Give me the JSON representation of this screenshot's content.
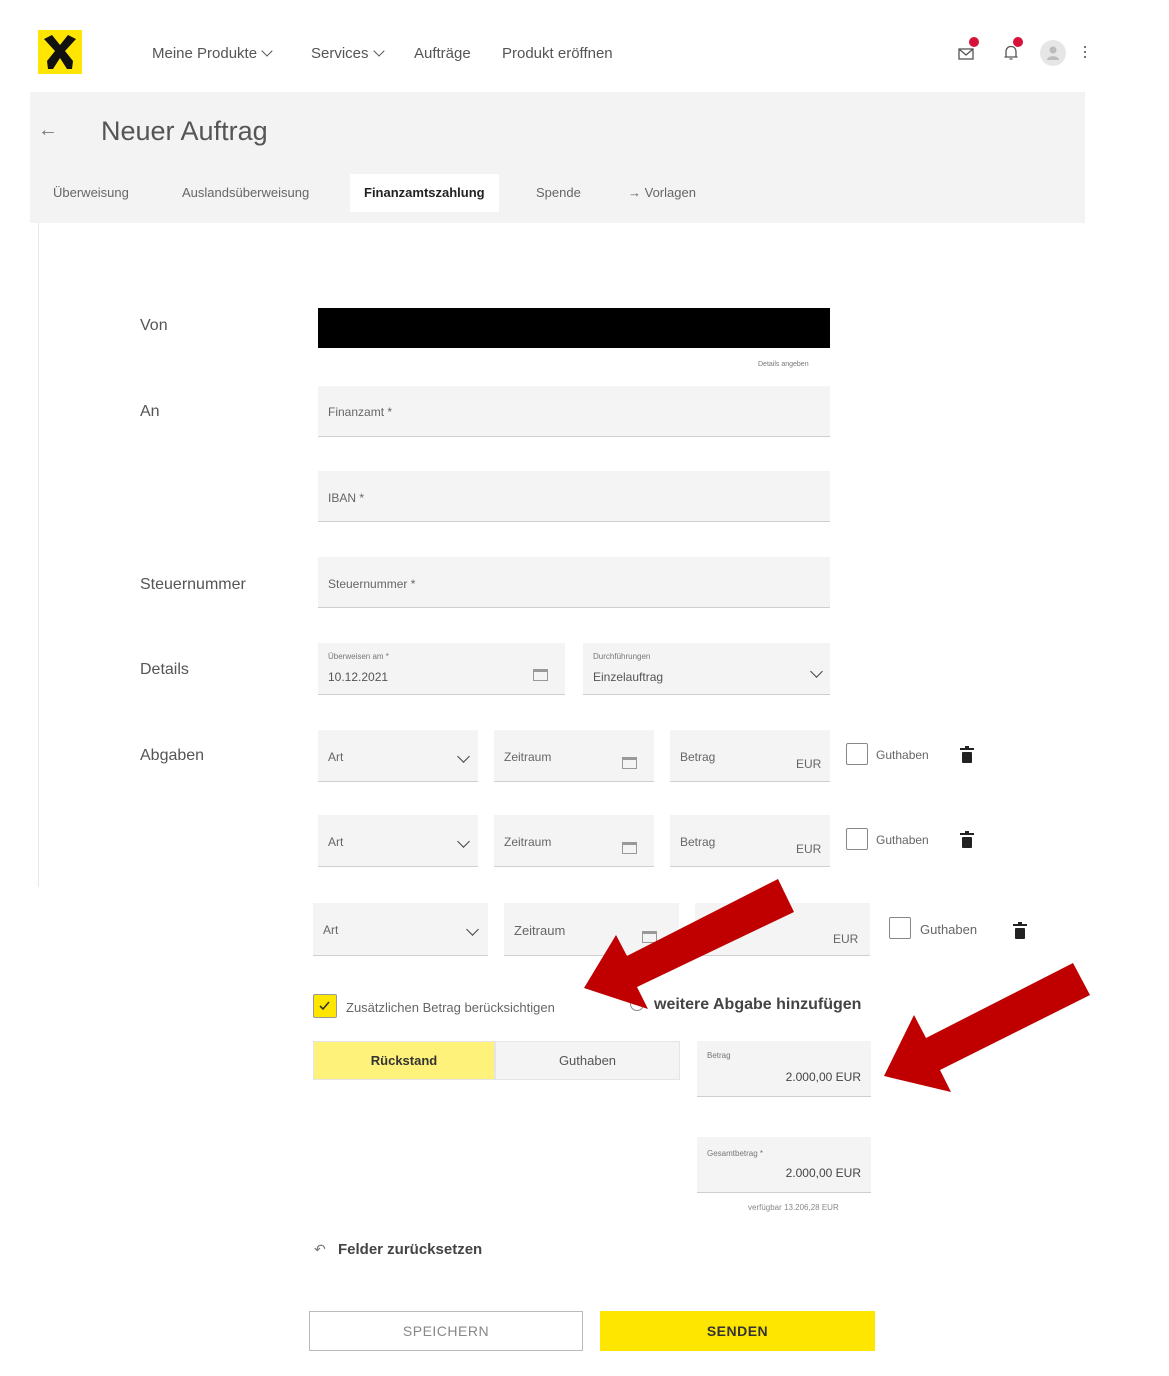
{
  "brand": {
    "accent": "#ffe600",
    "logo": "raiffeisen-gable-cross-logo"
  },
  "nav": {
    "items": [
      "Meine Produkte",
      "Services",
      "Aufträge",
      "Produkt eröffnen"
    ]
  },
  "header": {
    "title": "Neuer Auftrag"
  },
  "tabs": [
    {
      "label": "Überweisung"
    },
    {
      "label": "Auslandsüberweisung"
    },
    {
      "label": "Finanzamtszahlung",
      "active": true
    },
    {
      "label": "Spende"
    },
    {
      "label": "→ Vorlagen"
    }
  ],
  "form": {
    "von_label": "Von",
    "details_link": "Details angeben",
    "an_label": "An",
    "finanzamt_placeholder": "Finanzamt *",
    "iban_placeholder": "IBAN *",
    "steuernummer_label": "Steuernummer",
    "steuernummer_placeholder": "Steuernummer *",
    "details_label": "Details",
    "ueberweisen_am_label": "Überweisen am *",
    "ueberweisen_am_value": "10.12.2021",
    "durchfuehrungen_label": "Durchführungen",
    "durchfuehrungen_value": "Einzelauftrag",
    "abgaben_label": "Abgaben",
    "abgaben_rows": [
      {
        "art": "Art",
        "zeitraum": "Zeitraum",
        "betrag": "Betrag",
        "currency": "EUR",
        "guthaben": "Guthaben"
      },
      {
        "art": "Art",
        "zeitraum": "Zeitraum",
        "betrag": "Betrag",
        "currency": "EUR",
        "guthaben": "Guthaben"
      },
      {
        "art": "Art",
        "zeitraum": "Zeitraum",
        "currency": "EUR",
        "guthaben": "Guthaben"
      }
    ],
    "zusaetzlich_label": "Zusätzlichen Betrag berücksichtigen",
    "add_abgabe_label": "weitere Abgabe hinzufügen",
    "toggle": {
      "rueckstand": "Rückstand",
      "guthaben": "Guthaben"
    },
    "betrag_small_label": "Betrag",
    "betrag_value": "2.000,00 EUR",
    "gesamtbetrag_label": "Gesamtbetrag *",
    "gesamtbetrag_value": "2.000,00 EUR",
    "verfuegbar": "verfügbar 13.206,28 EUR",
    "reset_label": "Felder zurücksetzen",
    "save_button": "SPEICHERN",
    "send_button": "SENDEN"
  },
  "annotation_color": "#c00000"
}
